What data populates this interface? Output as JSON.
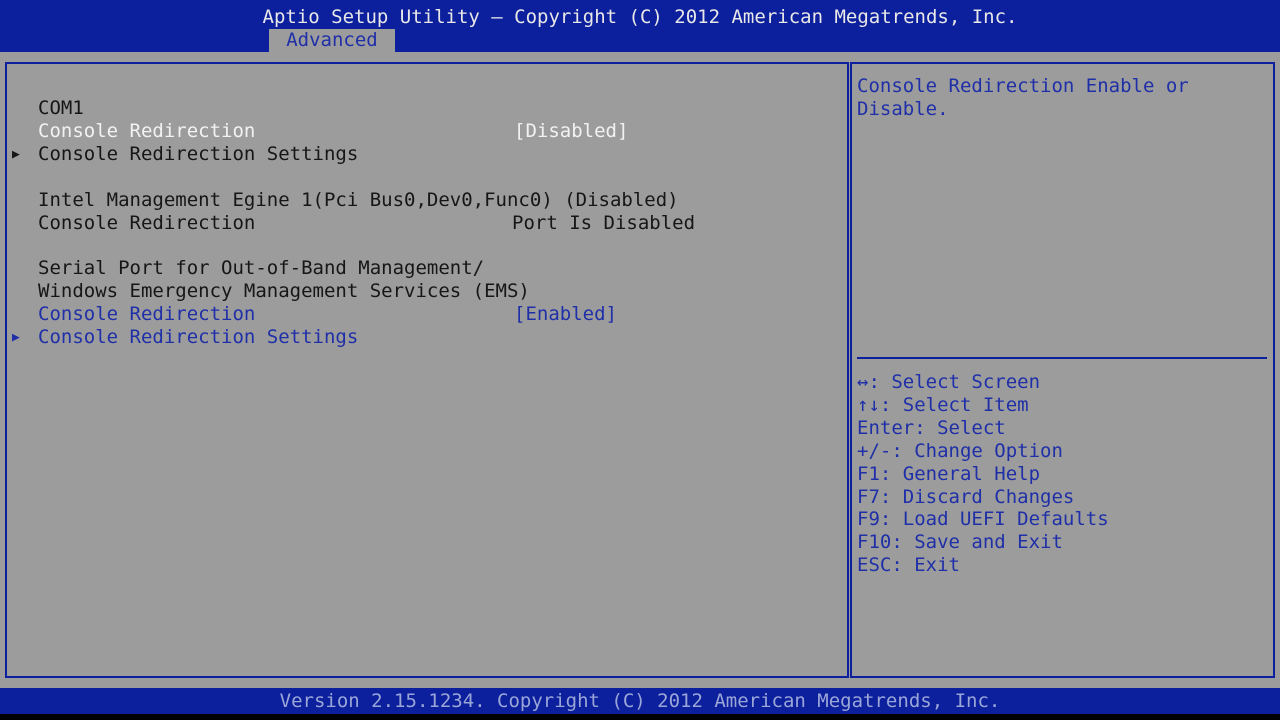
{
  "header": {
    "title": "Aptio Setup Utility – Copyright (C) 2012 American Megatrends, Inc.",
    "tab_label": "Advanced"
  },
  "sections": {
    "com1": {
      "heading": "COM1",
      "console_redirection": {
        "label": "Console Redirection",
        "value": "[Disabled]"
      },
      "settings_label": "Console Redirection Settings",
      "submenu_arrow": "▶"
    },
    "intel_me": {
      "heading": "Intel Management Egine 1(Pci Bus0,Dev0,Func0) (Disabled)",
      "console_redirection": {
        "label": "Console Redirection",
        "value": "Port Is Disabled"
      }
    },
    "ems": {
      "heading_line1": "Serial Port for Out-of-Band Management/",
      "heading_line2": "Windows Emergency Management Services (EMS)",
      "console_redirection": {
        "label": "Console Redirection",
        "value": "[Enabled]"
      },
      "settings_label": "Console Redirection Settings",
      "submenu_arrow": "▶"
    }
  },
  "help": {
    "description_line1": "Console Redirection Enable or",
    "description_line2": "Disable.",
    "keys": [
      "↔: Select Screen",
      "↑↓: Select Item",
      "Enter: Select",
      "+/-: Change Option",
      "F1: General Help",
      "F7: Discard Changes",
      "F9: Load UEFI Defaults",
      "F10: Save and Exit",
      "ESC: Exit"
    ]
  },
  "footer": {
    "text": "Version 2.15.1234. Copyright (C) 2012 American Megatrends, Inc."
  },
  "colors": {
    "bar_blue": "#0c1f9c",
    "panel_gray": "#9c9c9c",
    "highlight_text": "#f2f2f2",
    "selected_text": "#1f2fa8",
    "normal_text": "#161616"
  }
}
